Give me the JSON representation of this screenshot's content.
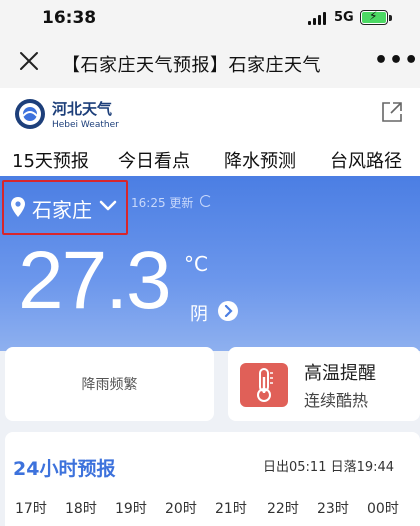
{
  "status_bar": {
    "time": "16:38",
    "network": "5G"
  },
  "nav": {
    "title": "【石家庄天气预报】石家庄天气"
  },
  "site": {
    "name_cn": "河北天气",
    "name_en": "Hebei Weather"
  },
  "tabs": [
    "15天预报",
    "今日看点",
    "降水预测",
    "台风路径"
  ],
  "weather": {
    "city": "石家庄",
    "update_time": "16:25 更新",
    "temperature": "27.3",
    "unit": "°C",
    "condition": "阴"
  },
  "cards": {
    "rain": "降雨频繁",
    "warning_title": "高温提醒",
    "warning_sub": "连续酷热"
  },
  "forecast": {
    "title": "24小时预报",
    "sunrise_sunset": "日出05:11 日落19:44",
    "hours": [
      "17时",
      "18时",
      "19时",
      "20时",
      "21时",
      "22时",
      "23时",
      "00时"
    ]
  },
  "colors": {
    "accent": "#3d72dc",
    "hero_top": "#4b7ee3",
    "highlight_box": "#d7262c",
    "warning": "#e06058"
  },
  "icons": {
    "close": "close-icon",
    "more": "more-icon",
    "share": "share-icon",
    "location": "location-pin-icon",
    "dropdown": "chevron-down-icon",
    "refresh": "refresh-icon",
    "thermometer": "thermometer-icon"
  }
}
